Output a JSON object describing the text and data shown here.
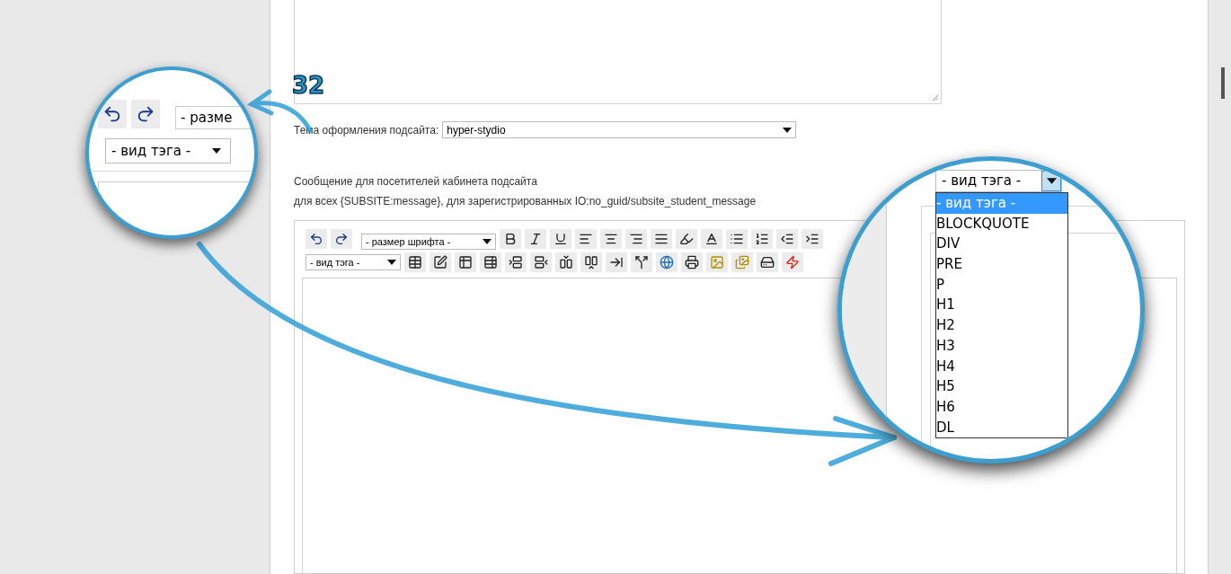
{
  "step_number": "32",
  "theme_field": {
    "label": "Тема оформления подсайта:",
    "value": "hyper-stydio"
  },
  "message_field": {
    "label_lines": [
      "Сообщение для посетителей кабинета подсайта",
      "для всех {SUBSITE:message}, для зарегистрированных IO:no_guid/subsite_student_message"
    ]
  },
  "editor": {
    "font_size_select": {
      "value": "- размер шрифта -"
    },
    "tag_select": {
      "value": "- вид тэга -"
    }
  },
  "magnifier_left": {
    "font_size_select": {
      "value": "- разме"
    },
    "tag_select": {
      "value": "- вид тэга -"
    }
  },
  "magnifier_right": {
    "tag_select": {
      "value": "- вид тэга -",
      "expanded": true
    },
    "options": [
      {
        "label": "- вид тэга -",
        "selected": true
      },
      {
        "label": "BLOCKQUOTE",
        "selected": false
      },
      {
        "label": "DIV",
        "selected": false
      },
      {
        "label": "PRE",
        "selected": false
      },
      {
        "label": "P",
        "selected": false
      },
      {
        "label": "H1",
        "selected": false
      },
      {
        "label": "H2",
        "selected": false
      },
      {
        "label": "H3",
        "selected": false
      },
      {
        "label": "H4",
        "selected": false
      },
      {
        "label": "H5",
        "selected": false
      },
      {
        "label": "H6",
        "selected": false
      },
      {
        "label": "DL",
        "selected": false
      }
    ]
  }
}
